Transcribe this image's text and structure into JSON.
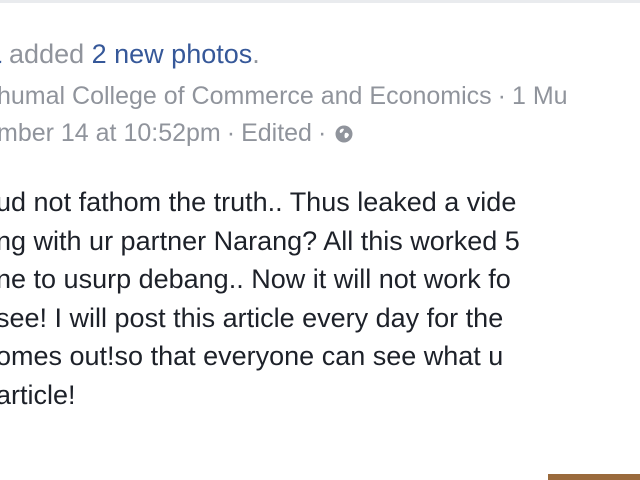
{
  "post": {
    "author_fragment": "a",
    "action_prefix": "added ",
    "action_link": "2 new photos",
    "action_suffix": ".",
    "location": "humal College of Commerce and Economics",
    "separator": "·",
    "location_extra": "1 Mu",
    "timestamp": "mber 14 at 10:52pm",
    "edited_label": "Edited",
    "audience_icon": "globe-icon",
    "body_lines": [
      "ud not fathom the truth.. Thus leaked a vide",
      "ng with ur partner Narang? All this worked 5",
      "ne to usurp debang.. Now it will not work fo",
      "see! I will post this article every day for the",
      "omes out!so that everyone can see what u",
      "article!"
    ]
  },
  "colors": {
    "link_blue": "#365899",
    "meta_gray": "#90949c",
    "text_dark": "#1d2129"
  }
}
